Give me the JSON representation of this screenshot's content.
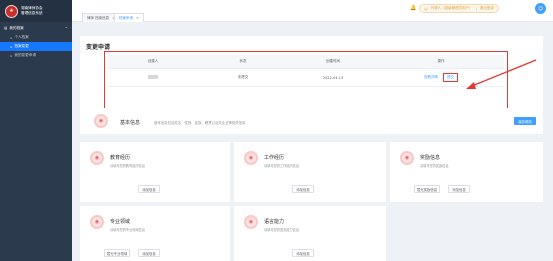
{
  "sidebar": {
    "org_line1": "湖南律师协会",
    "org_line2": "管理信息系统",
    "group_label": "我的档案",
    "items": [
      {
        "label": "个人档案"
      },
      {
        "label": "档案变更"
      },
      {
        "label": "我的变更申请"
      }
    ]
  },
  "topbar": {
    "tabs": [
      {
        "label": "律师 档案信息"
      },
      {
        "label": "档案申请"
      }
    ],
    "user_label": "代理人（超级管理员用户）",
    "logout_label": "退出登录"
  },
  "change_request": {
    "title": "变更申请",
    "columns": [
      "创建人",
      "状态",
      "创建时间",
      "操作"
    ],
    "row": {
      "creator": "",
      "status": "未提交",
      "created_at": "2022-04-13",
      "action_view": "查看详情",
      "action_submit": "提交"
    }
  },
  "basic_info": {
    "title": "基本信息",
    "desc": "基本信息包括姓名、性别、民族、籍贯以及执业证等相关信息",
    "button": "保存修改"
  },
  "modules": [
    {
      "title": "教育经历",
      "desc": "请填写您的教育经历信息",
      "button": "添加信息"
    },
    {
      "title": "工作经历",
      "desc": "请填写您的工作经历信息",
      "button": "添加信息"
    },
    {
      "title": "奖励信息",
      "desc": "请填写您的奖励信息",
      "button": "暂无奖励信息"
    },
    {
      "title": "专业领域",
      "desc": "请填写您的专业领域信息",
      "button": "暂无专业领域"
    },
    {
      "title": "语言能力",
      "desc": "请填写您的语言能力信息",
      "button": "添加信息"
    }
  ],
  "module_extra_button": "添加信息",
  "colors": {
    "sidebar_bg": "#2c3a4d",
    "active_nav": "#1677ff",
    "accent": "#409eff",
    "highlight": "#e53935"
  }
}
